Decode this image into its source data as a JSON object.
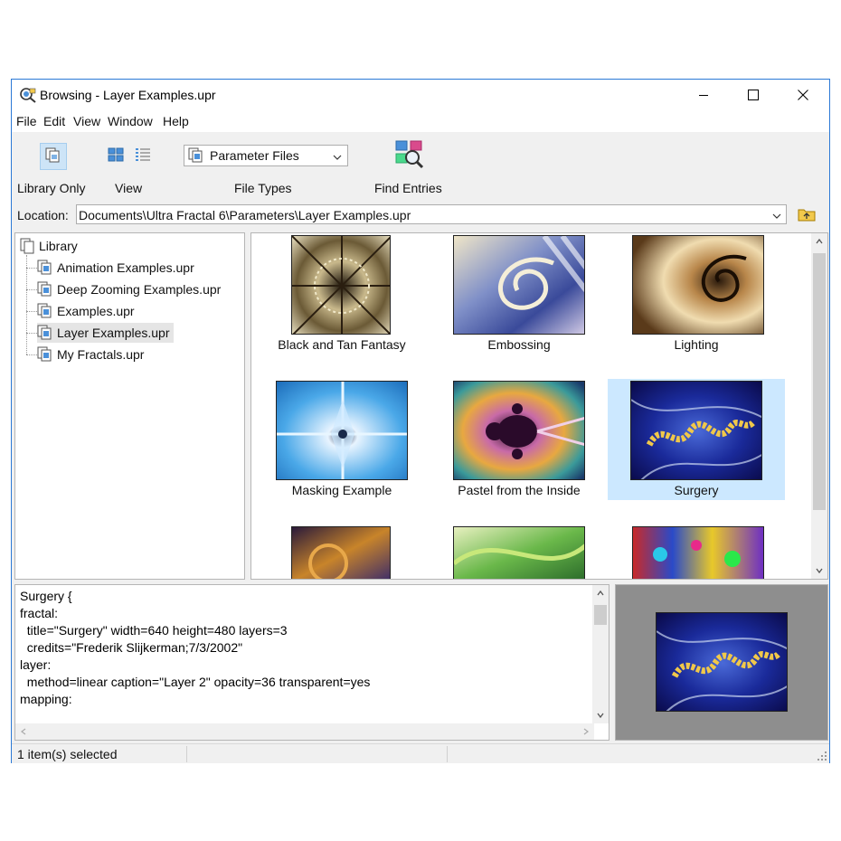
{
  "window": {
    "title": "Browsing - Layer Examples.upr"
  },
  "menu": [
    "File",
    "Edit",
    "View",
    "Window",
    "Help"
  ],
  "toolbar": {
    "library_only_label": "Library Only",
    "view_label": "View",
    "file_types_label": "File Types",
    "file_types_value": "Parameter Files",
    "find_entries_label": "Find Entries"
  },
  "location": {
    "label": "Location:",
    "value": "Documents\\Ultra Fractal 6\\Parameters\\Layer Examples.upr"
  },
  "tree": {
    "root": "Library",
    "items": [
      "Animation Examples.upr",
      "Deep Zooming Examples.upr",
      "Examples.upr",
      "Layer Examples.upr",
      "My Fractals.upr"
    ],
    "selected": "Layer Examples.upr"
  },
  "grid": {
    "entries": [
      "Black and Tan Fantasy",
      "Embossing",
      "Lighting",
      "Masking Example",
      "Pastel from the Inside",
      "Surgery"
    ],
    "selected": "Surgery"
  },
  "source": {
    "lines": [
      "Surgery {",
      "fractal:",
      "  title=\"Surgery\" width=640 height=480 layers=3",
      "  credits=\"Frederik Slijkerman;7/3/2002\"",
      "layer:",
      "  method=linear caption=\"Layer 2\" opacity=36 transparent=yes",
      "mapping:"
    ]
  },
  "status": {
    "text": "1 item(s) selected"
  },
  "colors": {
    "window_border": "#2b79d6",
    "selection": "#cce8ff",
    "toolbar_active": "#cde4f7",
    "preview_bg": "#8e8e8e"
  }
}
